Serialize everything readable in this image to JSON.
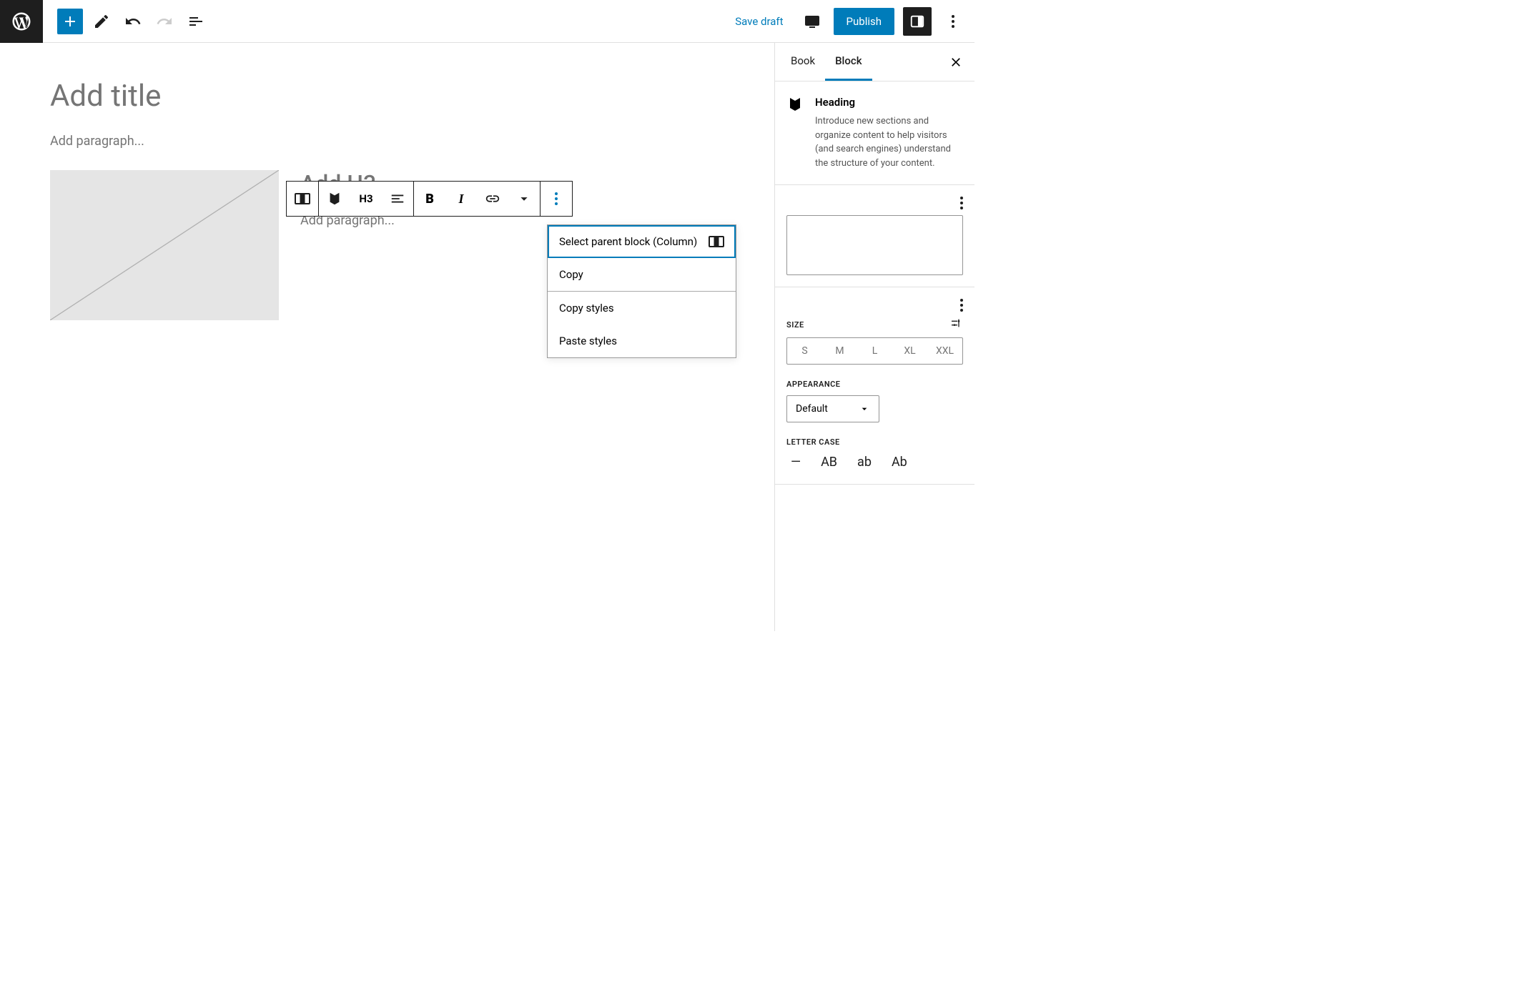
{
  "topbar": {
    "save_draft": "Save draft",
    "publish": "Publish"
  },
  "editor": {
    "title_placeholder": "Add title",
    "paragraph_placeholder": "Add paragraph...",
    "h3_placeholder": "Add H3...",
    "paragraph_placeholder_2": "Add paragraph..."
  },
  "block_toolbar": {
    "heading_level": "H3"
  },
  "context_menu": {
    "select_parent": "Select parent block (Column)",
    "copy": "Copy",
    "copy_styles": "Copy styles",
    "paste_styles": "Paste styles"
  },
  "sidebar": {
    "tabs": {
      "book": "Book",
      "block": "Block"
    },
    "block_info": {
      "title": "Heading",
      "description": "Introduce new sections and organize content to help visitors (and search engines) understand the structure of your content."
    },
    "size": {
      "label": "SIZE",
      "options": [
        "S",
        "M",
        "L",
        "XL",
        "XXL"
      ]
    },
    "appearance": {
      "label": "APPEARANCE",
      "value": "Default"
    },
    "letter_case": {
      "label": "LETTER CASE",
      "options": [
        "—",
        "AB",
        "ab",
        "Ab"
      ]
    }
  }
}
